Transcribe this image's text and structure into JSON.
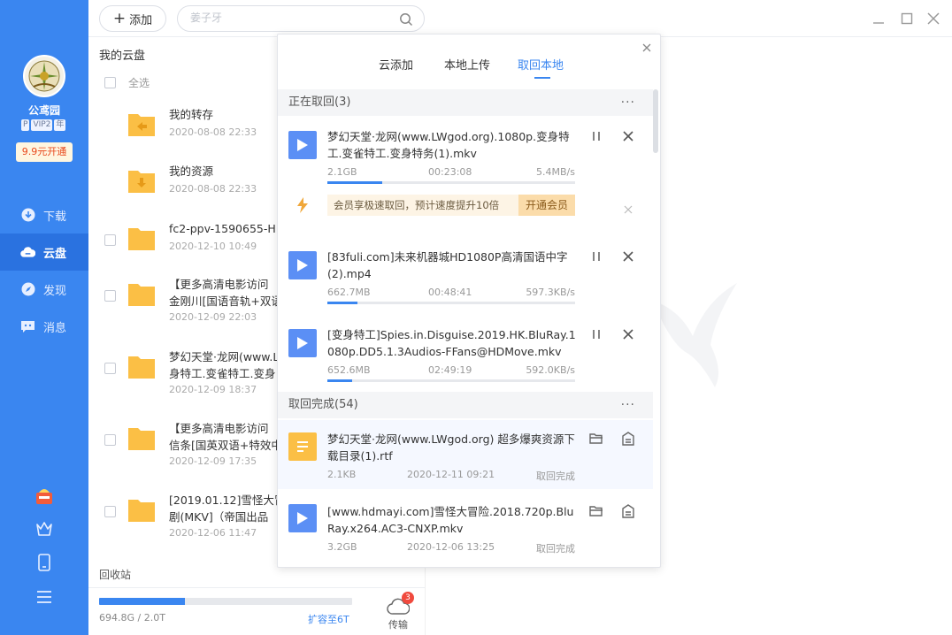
{
  "sidebar": {
    "username": "公鸢园",
    "badges": [
      "P",
      "VIP2",
      "年"
    ],
    "promo": "9.9元开通",
    "nav": [
      {
        "label": "下载",
        "icon": "download-icon"
      },
      {
        "label": "云盘",
        "icon": "cloud-icon",
        "active": true
      },
      {
        "label": "发现",
        "icon": "compass-icon"
      },
      {
        "label": "消息",
        "icon": "message-icon"
      }
    ],
    "bottom_icons": [
      "gift-box-icon",
      "crown-icon",
      "phone-icon",
      "menu-icon"
    ]
  },
  "toolbar": {
    "add_label": "添加",
    "search_placeholder": "姜子牙"
  },
  "files": {
    "breadcrumb": "我的云盘",
    "select_all": "全选",
    "items": [
      {
        "name": "我的转存",
        "date": "2020-08-08 22:33",
        "type": "transfer-folder"
      },
      {
        "name": "我的资源",
        "date": "2020-08-08 22:33",
        "type": "resource-folder"
      },
      {
        "name": "fc2-ppv-1590655-H",
        "date": "2020-12-10 10:49",
        "type": "folder"
      },
      {
        "name": "【更多高清电影访问 \n金刚川[国语音轨+双语",
        "date": "2020-12-09 22:03",
        "type": "folder"
      },
      {
        "name": "梦幻天堂·龙网(www.L\n身特工.变雀特工.变身",
        "date": "2020-12-09 18:37",
        "type": "folder"
      },
      {
        "name": "【更多高清电影访问 \n信条[国英双语+特效中",
        "date": "2020-12-09 17:35",
        "type": "folder"
      },
      {
        "name": "[2019.01.12]雪怪大冒\n剧(MKV]（帝国出品",
        "date": "2020-12-06 11:47",
        "type": "folder"
      }
    ],
    "recycle": "回收站",
    "storage_text": "694.8G / 2.0T",
    "storage_fraction": 0.34,
    "expand_label": "扩容至6T",
    "transfer_label": "传输",
    "transfer_count": "3"
  },
  "popup": {
    "tabs": [
      "云添加",
      "本地上传",
      "取回本地"
    ],
    "active_tab": 2,
    "in_progress": {
      "title": "正在取回(3)",
      "more": "···",
      "tasks": [
        {
          "name": "梦幻天堂·龙网(www.LWgod.org).1080p.变身特工.变雀特工.变身特务(1).mkv",
          "size": "2.1GB",
          "time": "00:23:08",
          "speed": "5.4MB/s",
          "progress": 0.22
        },
        {
          "name": "[83fuli.com]未来机器城HD1080P高清国语中字(2).mp4",
          "size": "662.7MB",
          "time": "00:48:41",
          "speed": "597.3KB/s",
          "progress": 0.12
        },
        {
          "name": "[变身特工]Spies.in.Disguise.2019.HK.BluRay.1080p.DD5.1.3Audios-FFans@HDMove.mkv",
          "size": "652.6MB",
          "time": "02:49:19",
          "speed": "592.0KB/s",
          "progress": 0.1
        }
      ],
      "vip_text": "会员享极速取回，预计速度提升10倍",
      "vip_button": "开通会员"
    },
    "completed": {
      "title": "取回完成(54)",
      "more": "···",
      "tasks": [
        {
          "name": "梦幻天堂·龙网(www.LWgod.org) 超多爆爽资源下载目录(1).rtf",
          "size": "2.1KB",
          "date": "2020-12-11 09:21",
          "status": "取回完成",
          "type": "doc"
        },
        {
          "name": "[www.hdmayi.com]雪怪大冒险.2018.720p.BluRay.x264.AC3-CNXP.mkv",
          "size": "3.2GB",
          "date": "2020-12-06 13:25",
          "status": "取回完成",
          "type": "video"
        }
      ]
    }
  },
  "colors": {
    "brand": "#3a86f0",
    "sidebar_active": "#2a72e0",
    "folder": "#fbbf45",
    "video_icon": "#5b8ff5",
    "badge_red": "#f04a3e"
  }
}
